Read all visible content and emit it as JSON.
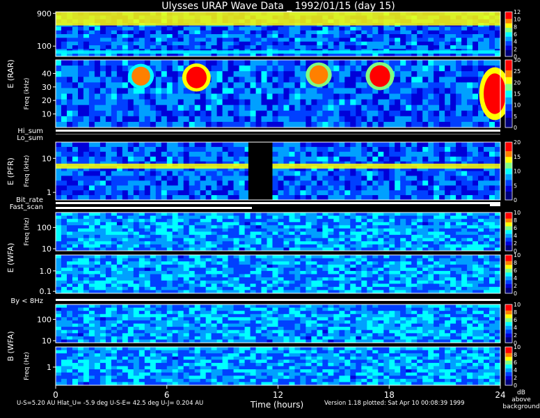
{
  "title": "Ulysses URAP Wave Data _ 1992/01/15  (day 15)",
  "colors": {
    "background": "#000000",
    "text": "#ffffff",
    "colormap": [
      "#00007a",
      "#0000d8",
      "#0040ff",
      "#00a0ff",
      "#00ffff",
      "#80ff80",
      "#ffff00",
      "#ff8000",
      "#ff0000"
    ]
  },
  "instrument_labels": [
    {
      "key": "rar",
      "text": "E (RAR)"
    },
    {
      "key": "pfr",
      "text": "E (PFR)"
    },
    {
      "key": "wfa_e",
      "text": "E (WFA)"
    },
    {
      "key": "wfa_b",
      "text": "B (WFA)"
    }
  ],
  "status_labels": [
    "Hi_sum",
    "Lo_sum",
    "Bit_rate",
    "Fast_scan",
    "By < 8Hz"
  ],
  "bottom": {
    "xlabel": "Time (hours)",
    "orbit_info": "U-S=5.20 AU  Hlat_U= -5.9 deg  U-S-E= 42.5 deg  U-J= 0.204 AU",
    "version_info": "Version 1.18 plotted: Sat Apr 10 00:08:39 1999",
    "colorbar_unit": [
      "dB",
      "above",
      "background"
    ]
  },
  "chart_data": {
    "type": "heatmap",
    "title": "Ulysses URAP Wave Data _ 1992/01/15  (day 15)",
    "xlabel": "Time (hours)",
    "xlim": [
      0,
      24
    ],
    "x_ticks": [
      "0",
      "6",
      "12",
      "18",
      "24"
    ],
    "panels": [
      {
        "id": "rar-high",
        "ylabel": "",
        "yscale": "log",
        "ylim": [
          50,
          1000
        ],
        "y_ticks": [
          "100",
          "900"
        ],
        "colorbar": {
          "range": [
            0,
            12
          ],
          "ticks": [
            "0",
            "2",
            "4",
            "6",
            "8",
            "10",
            "12"
          ]
        },
        "features": [
          {
            "type": "band",
            "t_start": 0,
            "t_end": 24,
            "f_low": 60,
            "f_high": 75,
            "level": 0.55
          },
          {
            "type": "region",
            "t_start": 0,
            "t_end": 24,
            "f_low": 400,
            "f_high": 1000,
            "level": 0.7
          }
        ]
      },
      {
        "id": "rar-low",
        "ylabel": "Freq (kHz)",
        "yscale": "linear",
        "ylim": [
          0,
          50
        ],
        "y_ticks": [
          "10",
          "20",
          "30",
          "40"
        ],
        "colorbar": {
          "range": [
            0,
            30
          ],
          "ticks": [
            "0",
            "5",
            "10",
            "15",
            "20",
            "25",
            "30"
          ]
        },
        "features": [
          {
            "type": "burst",
            "t": 4.6,
            "f": 38,
            "width_h": 0.5,
            "height_f": 14,
            "level": 0.78
          },
          {
            "type": "burst",
            "t": 7.6,
            "f": 37,
            "width_h": 0.55,
            "height_f": 16,
            "level": 0.97
          },
          {
            "type": "burst",
            "t": 14.2,
            "f": 39,
            "width_h": 0.5,
            "height_f": 14,
            "level": 0.8
          },
          {
            "type": "burst",
            "t": 17.5,
            "f": 38,
            "width_h": 0.55,
            "height_f": 16,
            "level": 0.95
          },
          {
            "type": "burst",
            "t": 23.7,
            "f": 25,
            "width_h": 0.6,
            "height_f": 30,
            "level": 1.0
          }
        ]
      },
      {
        "id": "pfr",
        "ylabel": "Freq (kHz)",
        "yscale": "log",
        "ylim": [
          0.6,
          30
        ],
        "y_ticks": [
          "1",
          "10"
        ],
        "colorbar": {
          "range": [
            0,
            20
          ],
          "ticks": [
            "0",
            "5",
            "10",
            "15",
            "20"
          ]
        },
        "features": [
          {
            "type": "band",
            "t_start": 0,
            "t_end": 24,
            "f_low": 5,
            "f_high": 7,
            "level": 0.7
          },
          {
            "type": "gap",
            "t_start": 10.4,
            "t_end": 11.7
          }
        ]
      },
      {
        "id": "wfa-e-high",
        "ylabel": "Freq (Hz)",
        "yscale": "log",
        "ylim": [
          8,
          500
        ],
        "y_ticks": [
          "10",
          "100"
        ],
        "colorbar": {
          "range": [
            0,
            10
          ],
          "ticks": [
            "0",
            "2",
            "4",
            "6",
            "8",
            "10"
          ]
        }
      },
      {
        "id": "wfa-e-low",
        "ylabel": "",
        "yscale": "log",
        "ylim": [
          0.08,
          6
        ],
        "y_ticks": [
          "0.1",
          "1.0"
        ],
        "colorbar": {
          "range": [
            0,
            10
          ],
          "ticks": [
            "0",
            "2",
            "4",
            "6",
            "8",
            "10"
          ]
        }
      },
      {
        "id": "wfa-b-high",
        "ylabel": "",
        "yscale": "log",
        "ylim": [
          8,
          500
        ],
        "y_ticks": [
          "10",
          "100"
        ],
        "colorbar": {
          "range": [
            0,
            10
          ],
          "ticks": [
            "0",
            "2",
            "4",
            "6",
            "8",
            "10"
          ]
        }
      },
      {
        "id": "wfa-b-low",
        "ylabel": "Freq (Hz)",
        "yscale": "log",
        "ylim": [
          0.2,
          6
        ],
        "y_ticks": [
          "1"
        ],
        "colorbar": {
          "range": [
            0,
            10
          ],
          "ticks": [
            "0",
            "2",
            "4",
            "6",
            "8",
            "10"
          ]
        }
      }
    ]
  }
}
